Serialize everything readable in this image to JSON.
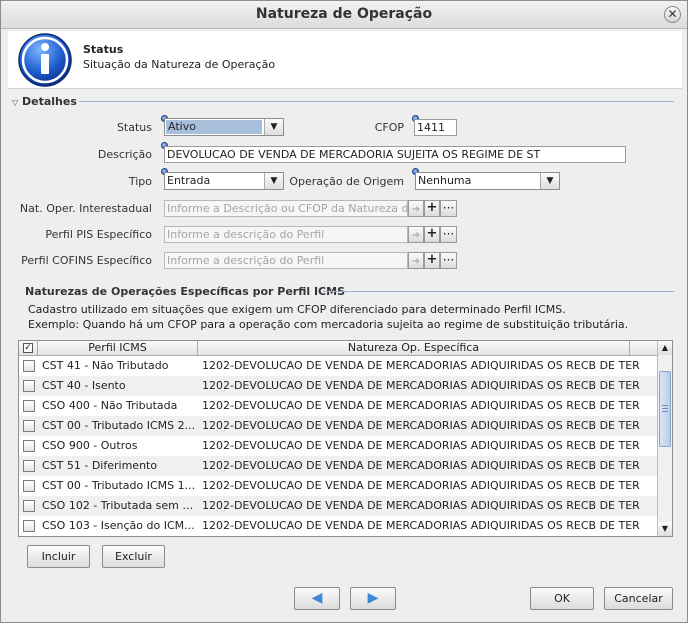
{
  "window": {
    "title": "Natureza de Operação"
  },
  "header": {
    "title": "Status",
    "subtitle": "Situação da Natureza de Operação"
  },
  "details": {
    "section_title": "Detalhes",
    "status_label": "Status",
    "status_value": "Ativo",
    "cfop_label": "CFOP",
    "cfop_value": "1411",
    "descricao_label": "Descrição",
    "descricao_value": "DEVOLUCAO DE VENDA DE MERCADORIA SUJEITA OS REGIME DE ST",
    "tipo_label": "Tipo",
    "tipo_value": "Entrada",
    "operacao_origem_label": "Operação de Origem",
    "operacao_origem_value": "Nenhuma",
    "nat_interestadual_label": "Nat. Oper. Interestadual",
    "nat_interestadual_placeholder": "Informe a Descrição ou CFOP da Natureza de",
    "perfil_pis_label": "Perfil PIS Específico",
    "perfil_pis_placeholder": "Informe a descrição do Perfil",
    "perfil_cofins_label": "Perfil COFINS Específico",
    "perfil_cofins_placeholder": "Informe a descrição do Perfil",
    "plus_label": "+",
    "more_label": "···"
  },
  "icms": {
    "section_title": "Naturezas de Operações Específicas por Perfil ICMS",
    "desc_line1": "Cadastro utilizado em situações que exigem um CFOP diferenciado para determinado Perfil ICMS.",
    "desc_line2": "Exemplo: Quando há um CFOP para a operação com mercadoria sujeita ao regime de substituição tributária.",
    "col_perfil": "Perfil ICMS",
    "col_natureza": "Natureza Op. Específica",
    "rows": [
      {
        "perfil": "CST 41 - Não Tributado",
        "natureza": "1202-DEVOLUCAO DE VENDA DE MERCADORIAS ADIQUIRIDAS OS RECB DE TER"
      },
      {
        "perfil": "CST 40 - Isento",
        "natureza": "1202-DEVOLUCAO DE VENDA DE MERCADORIAS ADIQUIRIDAS OS RECB DE TER"
      },
      {
        "perfil": "CSO 400 - Não Tributada",
        "natureza": "1202-DEVOLUCAO DE VENDA DE MERCADORIAS ADIQUIRIDAS OS RECB DE TER"
      },
      {
        "perfil": "CST 00 - Tributado ICMS 2...",
        "natureza": "1202-DEVOLUCAO DE VENDA DE MERCADORIAS ADIQUIRIDAS OS RECB DE TER"
      },
      {
        "perfil": "CSO 900 - Outros",
        "natureza": "1202-DEVOLUCAO DE VENDA DE MERCADORIAS ADIQUIRIDAS OS RECB DE TER"
      },
      {
        "perfil": "CST 51 - Diferimento",
        "natureza": "1202-DEVOLUCAO DE VENDA DE MERCADORIAS ADIQUIRIDAS OS RECB DE TER"
      },
      {
        "perfil": "CST 00 - Tributado ICMS 1...",
        "natureza": "1202-DEVOLUCAO DE VENDA DE MERCADORIAS ADIQUIRIDAS OS RECB DE TER"
      },
      {
        "perfil": "CSO 102 - Tributada sem P...",
        "natureza": "1202-DEVOLUCAO DE VENDA DE MERCADORIAS ADIQUIRIDAS OS RECB DE TER"
      },
      {
        "perfil": "CSO 103 - Isenção do ICM...",
        "natureza": "1202-DEVOLUCAO DE VENDA DE MERCADORIAS ADIQUIRIDAS OS RECB DE TER"
      }
    ],
    "incluir_label": "Incluir",
    "excluir_label": "Excluir"
  },
  "footer": {
    "ok_label": "OK",
    "cancel_label": "Cancelar"
  },
  "colors": {
    "accent": "#3f86d6",
    "selection": "#a8bfdc",
    "section_line": "#9fb1c8"
  }
}
